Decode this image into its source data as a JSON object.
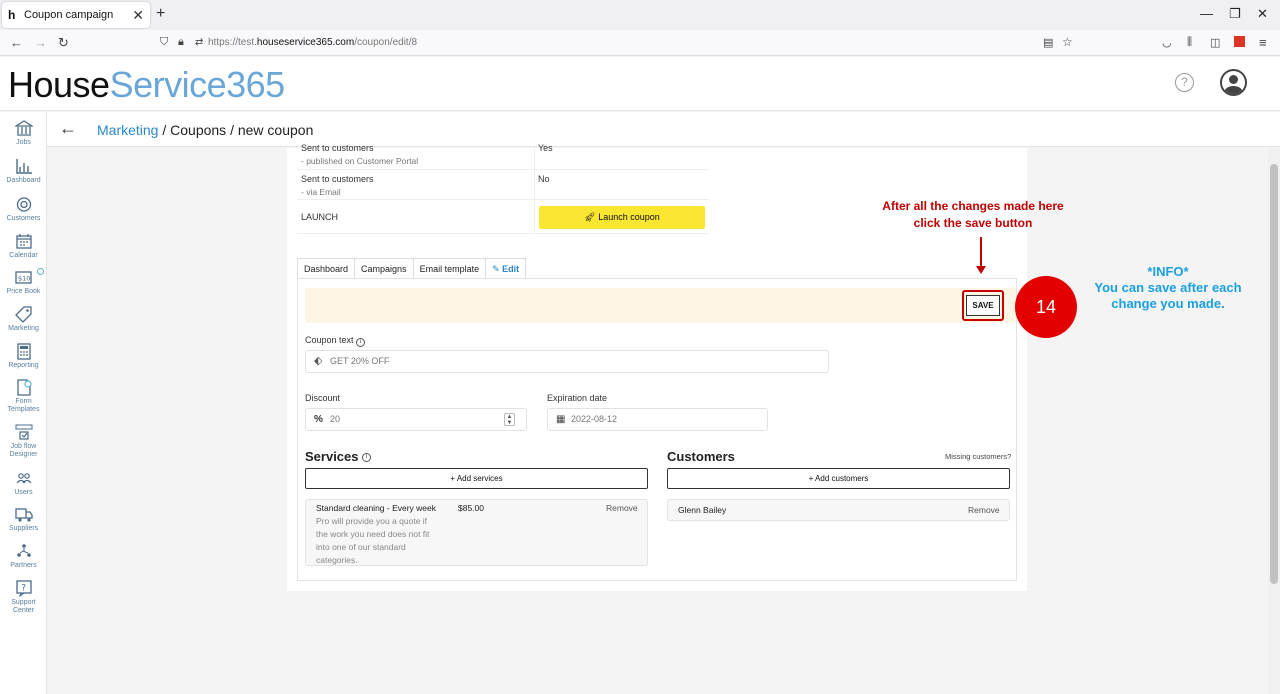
{
  "browser": {
    "tab_title": "Coupon campaign",
    "tab_close": "✕",
    "new_tab": "+",
    "url_prefix": "https://test.",
    "url_domain": "houseservice365.com",
    "url_path": "/coupon/edit/8"
  },
  "app": {
    "logo_house": "House",
    "logo_service": "Service365",
    "help": "?"
  },
  "breadcrumb": {
    "back": "←",
    "root": "Marketing",
    "rest": " / Coupons / new coupon"
  },
  "sidebar": {
    "items": [
      {
        "label": "Jobs",
        "icon": "bank-icon"
      },
      {
        "label": "Dashboard",
        "icon": "bar-chart-icon"
      },
      {
        "label": "Customers",
        "icon": "target-icon"
      },
      {
        "label": "Calendar",
        "icon": "calendar-icon"
      },
      {
        "label": "Price Book",
        "icon": "price-tag-icon"
      },
      {
        "label": "Marketing",
        "icon": "tag-icon"
      },
      {
        "label": "Reporting",
        "icon": "calculator-icon"
      },
      {
        "label": "Form",
        "label2": "Templates",
        "icon": "form-icon"
      },
      {
        "label": "Job flow",
        "label2": "Designer",
        "icon": "flow-icon"
      },
      {
        "label": "Users",
        "icon": "users-icon"
      },
      {
        "label": "Suppliers",
        "icon": "truck-icon"
      },
      {
        "label": "Partners",
        "icon": "partners-icon"
      },
      {
        "label": "Support",
        "label2": "Center",
        "icon": "support-icon"
      }
    ]
  },
  "info_table": {
    "row1_key": "Sent to customers",
    "row1_sub": "- published on Customer Portal",
    "row1_value": "Yes",
    "row2_key": "Sent to customers",
    "row2_sub": "- via Email",
    "row2_value": "No",
    "row3_key": "LAUNCH",
    "launch_button": "Launch coupon"
  },
  "tabs": {
    "dashboard": "Dashboard",
    "campaigns": "Campaigns",
    "email_template": "Email template",
    "edit": "Edit"
  },
  "form": {
    "save": "SAVE",
    "coupon_text_label": "Coupon text",
    "coupon_text_value": "GET 20% OFF",
    "discount_label": "Discount",
    "discount_value": "20",
    "expiration_label": "Expiration date",
    "expiration_value": "2022-08-12"
  },
  "services": {
    "title": "Services",
    "add": "+ Add services",
    "item_name": "Standard cleaning - Every week",
    "item_price": "$85.00",
    "item_remove": "Remove",
    "item_desc": [
      "Pro will provide you a quote if",
      "the work you need does not fit",
      "into one of our standard",
      "categories."
    ]
  },
  "customers": {
    "title": "Customers",
    "missing": "Missing customers?",
    "add": "+ Add customers",
    "item_name": "Glenn Bailey",
    "item_remove": "Remove"
  },
  "annotation": {
    "red_line1": "After all the changes made here",
    "red_line2": "click the save button",
    "step_number": "14",
    "blue_line1": "*INFO*",
    "blue_line2": "You can save after each",
    "blue_line3": "change you  made."
  },
  "colors": {
    "accent": "#2b88c8",
    "launch": "#fbe632",
    "annotation_red": "#c00000",
    "annotation_blue": "#1aa0e0"
  }
}
